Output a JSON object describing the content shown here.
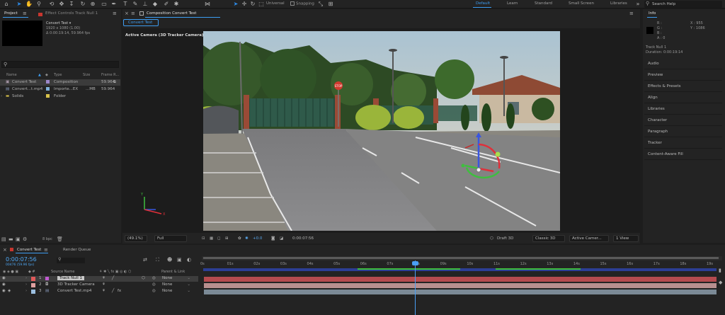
{
  "toolbar": {
    "universal": "Universal",
    "snapping": "Snapping",
    "search_placeholder": "Search Help"
  },
  "workspaces": [
    "Default",
    "Learn",
    "Standard",
    "Small Screen",
    "Libraries"
  ],
  "project": {
    "tab_label": "Project",
    "effect_controls_tab": "Effect Controls Track Null 1",
    "selected_name": "Convert Test ▾",
    "resolution": "1920 x 1080 (1.00)",
    "duration": "Δ 0:00:19:14, 59.964 fps",
    "columns": {
      "name": "Name",
      "type": "Type",
      "size": "Size",
      "fps": "Frame R..."
    },
    "items": [
      {
        "name": "Convert Test",
        "type": "Composition",
        "size": "",
        "fps": "59.964",
        "color": "#9b87c9"
      },
      {
        "name": "Convert...t.mp4",
        "type": "Importe...EX",
        "size": "...MB",
        "fps": "59.964",
        "color": "#7fb0d9"
      },
      {
        "name": "Solids",
        "type": "Folder",
        "size": "",
        "fps": "",
        "color": "#d8c24a"
      }
    ],
    "bpc": "8 bpc"
  },
  "composition": {
    "tab_label": "Composition Convert Test",
    "subtab": "Convert Test",
    "camera_label": "Active Camera (3D Tracker Camera)",
    "zoom": "(49.1%)",
    "resolution": "Full",
    "exposure": "+0.0",
    "timecode": "0:00:07:56",
    "renderer_label": "Draft 3D",
    "renderer": "Classic 3D",
    "view": "Active Camer...",
    "view_count": "1 View",
    "stop_sign": "STOP"
  },
  "info": {
    "title": "Info",
    "r": "R :",
    "g": "G :",
    "b": "B :",
    "a": "A : 0",
    "x": "X : 955",
    "y": "Y : 1086",
    "track_name": "Track Null 1",
    "track_duration": "Duration: 0:00:19:14"
  },
  "right_panels": [
    "Audio",
    "Preview",
    "Effects & Presets",
    "Align",
    "Libraries",
    "Character",
    "Paragraph",
    "Tracker",
    "Content-Aware Fill"
  ],
  "timeline": {
    "tab_label": "Convert Test",
    "render_queue": "Render Queue",
    "timecode": "0:00:07:56",
    "frames": "00476 (59.96 fps)",
    "col_source": "Source Name",
    "col_parent": "Parent & Link",
    "layers": [
      {
        "num": "1",
        "name": "Track Null 1",
        "parent": "None",
        "color": "#e05a5a"
      },
      {
        "num": "2",
        "name": "3D Tracker Camera",
        "parent": "None",
        "color": "#e0a0a0"
      },
      {
        "num": "3",
        "name": "Convert Test.mp4",
        "parent": "None",
        "color": "#9cbfe0"
      }
    ],
    "ticks": [
      "0s",
      "01s",
      "02s",
      "03s",
      "04s",
      "05s",
      "06s",
      "07s",
      "08s",
      "09s",
      "10s",
      "11s",
      "12s",
      "13s",
      "14s",
      "15s",
      "16s",
      "17s",
      "18s",
      "19s"
    ]
  }
}
